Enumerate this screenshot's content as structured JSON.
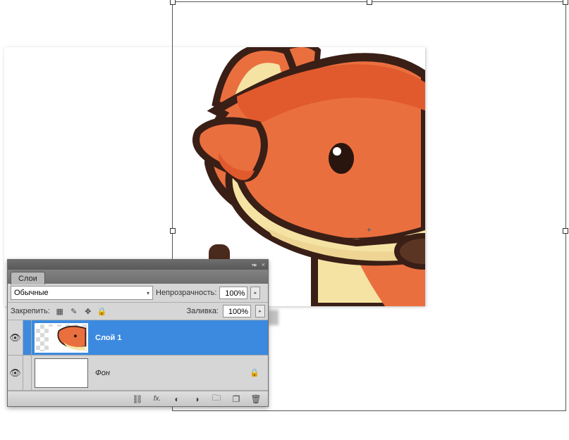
{
  "panel": {
    "tab_label": "Слои",
    "blend_mode": "Обычные",
    "opacity_label": "Непрозрачность:",
    "opacity_value": "100%",
    "lock_label": "Закрепить:",
    "fill_label": "Заливка:",
    "fill_value": "100%"
  },
  "layers": [
    {
      "name": "Слой 1",
      "visible": true,
      "selected": true,
      "locked": false,
      "thumb": "fox"
    },
    {
      "name": "Фон",
      "visible": true,
      "selected": false,
      "locked": true,
      "thumb": "white"
    }
  ],
  "icons": {
    "menu": "▾",
    "close": "×",
    "eye": "👁",
    "lock": "🔒",
    "dropdown": "▾",
    "spin": "▸",
    "lock_trans": "▦",
    "lock_paint": "✎",
    "lock_move": "✥",
    "lock_all": "🔒",
    "link": "⛓",
    "fx": "fx.",
    "mask": "◐",
    "adjust": "◑",
    "folder": "🗀",
    "new": "❐",
    "trash": "🗑"
  }
}
